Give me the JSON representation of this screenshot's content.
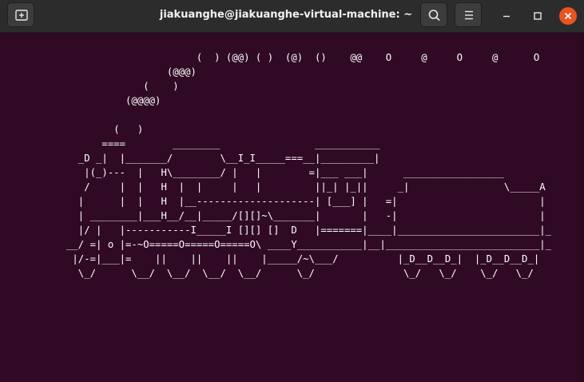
{
  "window": {
    "title": "jiakuanghe@jiakuanghe-virtual-machine: ~",
    "buttons": {
      "new_tab_icon": "new-tab-icon",
      "search_icon": "search-icon",
      "menu_icon": "hamburger-menu-icon",
      "minimize_icon": "minimize-icon",
      "maximize_icon": "maximize-icon",
      "close_icon": "close-icon"
    },
    "colors": {
      "titlebar": "#2c2c2c",
      "terminal_bg": "#300a24",
      "close_button": "#e95420",
      "text": "#ffffff"
    }
  },
  "terminal": {
    "ascii_art": "                      (  ) (@@) ( )  (@)  ()    @@    O     @     O     @      O\n                 (@@@)\n             (    )\n          (@@@@)\n\n        (   )\n      ====        ________                ___________\n  _D _|  |_______/        \\__I_I_____===__|_________|\n   |(_)---  |   H\\________/ |   |        =|___ ___|      _________________\n   /     |  |   H  |  |     |   |         ||_| |_||     _|                \\_____A\n  |      |  |   H  |__--------------------| [___] |   =|                        |\n  | ________|___H__/__|_____/[][]~\\_______|       |   -|                        |\n  |/ |   |-----------I_____I [][] []  D   |=======|____|________________________|_\n__/ =| o |=-~O=====O=====O=====O\\ ____Y___________|__|__________________________|_\n |/-=|___|=    ||    ||    ||    |_____/~\\___/          |_D__D__D_|  |_D__D__D_|\n  \\_/      \\__/  \\__/  \\__/  \\__/      \\_/               \\_/   \\_/    \\_/   \\_/"
  }
}
